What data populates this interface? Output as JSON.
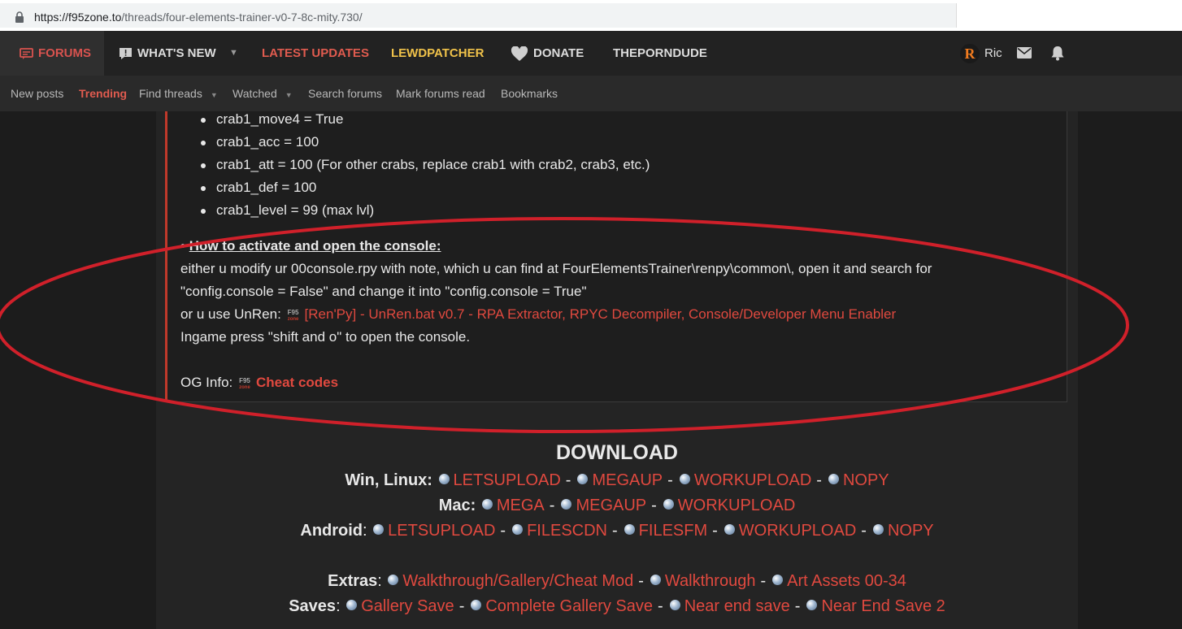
{
  "browser": {
    "url_host": "https://f95zone.to",
    "url_path": "/threads/four-elements-trainer-v0-7-8c-mity.730/"
  },
  "nav": {
    "forums": "FORUMS",
    "whats_new": "WHAT'S NEW",
    "latest_updates": "LATEST UPDATES",
    "lewdpatcher": "LEWDPATCHER",
    "donate": "DONATE",
    "theporndude": "THEPORNDUDE",
    "avatar_letter": "R",
    "user_name": "Ric"
  },
  "subnav": {
    "new_posts": "New posts",
    "trending": "Trending",
    "find_threads": "Find threads",
    "watched": "Watched",
    "search_forums": "Search forums",
    "mark_read": "Mark forums read",
    "bookmarks": "Bookmarks"
  },
  "post": {
    "bullets": [
      "crab1_move4 = True",
      "crab1_acc = 100",
      "crab1_att = 100 (For other crabs, replace crab1 with crab2, crab3, etc.)",
      "crab1_def = 100",
      "crab1_level = 99 (max lvl)"
    ],
    "console_heading": "How to activate and open the console:",
    "console_line1": "either u modify ur 00console.rpy with note, which u can find at FourElementsTrainer\\renpy\\common\\, open it and search for",
    "console_line2": "\"config.console = False\" and change it into \"config.console = True\"",
    "unren_prefix": "or u use UnRen:",
    "unren_link": "[Ren'Py] - UnRen.bat v0.7 - RPA Extractor, RPYC Decompiler, Console/Developer Menu Enabler",
    "ingame_line": "Ingame press \"shift and o\" to open the console.",
    "og_info_prefix": "OG Info:",
    "og_info_link": "Cheat codes"
  },
  "download": {
    "title": "DOWNLOAD",
    "win_label": "Win, Linux",
    "win_links": [
      "LETSUPLOAD",
      "MEGAUP",
      "WORKUPLOAD",
      "NOPY"
    ],
    "mac_label": "Mac",
    "mac_links": [
      "MEGA",
      "MEGAUP",
      "WORKUPLOAD"
    ],
    "android_label": "Android",
    "android_links": [
      "LETSUPLOAD",
      "FILESCDN",
      "FILESFM",
      "WORKUPLOAD",
      "NOPY"
    ],
    "extras_label": "Extras",
    "extras_links": [
      "Walkthrough/Gallery/Cheat Mod",
      "Walkthrough",
      "Art Assets 00-34"
    ],
    "saves_label": "Saves",
    "saves_links": [
      "Gallery Save",
      "Complete Gallery Save",
      "Near end save",
      "Near End Save 2"
    ]
  },
  "colors": {
    "accent_red": "#e0493f",
    "lewdpatcher_gold": "#f0c24a",
    "annotation_ellipse": "#d0202a"
  }
}
